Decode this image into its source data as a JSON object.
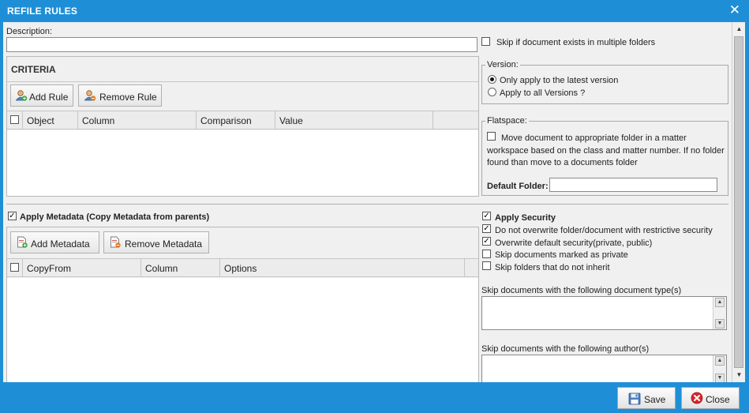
{
  "window": {
    "title": "REFILE RULES"
  },
  "description": {
    "label": "Description:",
    "value": ""
  },
  "skip_multiple": {
    "label": "Skip if document exists in multiple folders",
    "checked": false
  },
  "criteria": {
    "title": "CRITERIA",
    "add_rule": "Add Rule",
    "remove_rule": "Remove Rule",
    "columns": [
      "Object",
      "Column",
      "Comparison",
      "Value"
    ]
  },
  "version": {
    "legend": "Version:",
    "options": [
      {
        "label": "Only apply to the latest version",
        "selected": true
      },
      {
        "label": "Apply to all Versions ?",
        "selected": false
      }
    ]
  },
  "flatspace": {
    "legend": "Flatspace:",
    "move_text_line1": "Move document to appropriate folder in a matter",
    "move_text_line2": "workspace based on the class and matter number. If no folder",
    "move_text_line3": "found than move to a documents folder",
    "move_checked": false,
    "default_folder_label": "Default Folder:",
    "default_folder_value": ""
  },
  "metadata": {
    "apply_label": "Apply Metadata (Copy Metadata from parents)",
    "apply_checked": true,
    "add_metadata": "Add Metadata",
    "remove_metadata": "Remove Metadata",
    "columns": [
      "CopyFrom",
      "Column",
      "Options"
    ]
  },
  "security": {
    "apply_label": "Apply Security",
    "apply_checked": true,
    "options": [
      {
        "label": "Do not overwrite folder/document with restrictive security",
        "checked": true
      },
      {
        "label": "Overwrite default security(private, public)",
        "checked": true
      },
      {
        "label": "Skip documents marked as private",
        "checked": false
      },
      {
        "label": "Skip folders that do not inherit",
        "checked": false
      }
    ],
    "skip_doc_types_label": "Skip documents with the following document type(s)",
    "skip_authors_label": "Skip documents with the following author(s)"
  },
  "footer": {
    "save": "Save",
    "close": "Close"
  },
  "colors": {
    "titlebar": "#1e8fd6",
    "panel": "#f0f0f0",
    "close_icon": "#d9262b"
  }
}
